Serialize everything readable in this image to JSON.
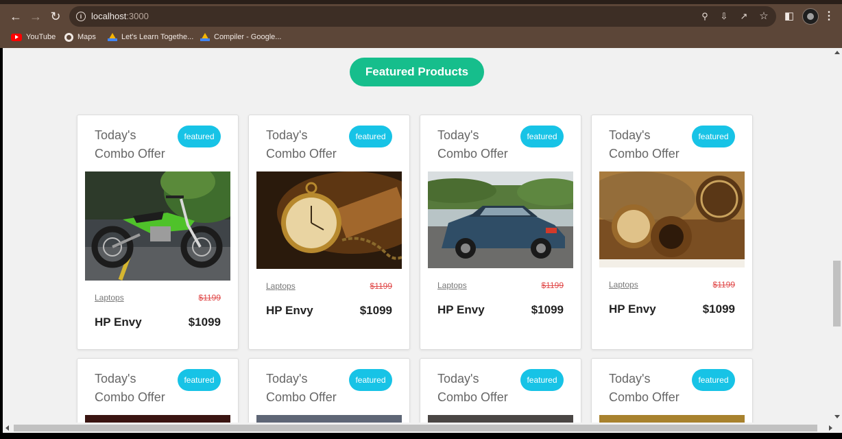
{
  "browser": {
    "url_host": "localhost",
    "url_port": ":3000",
    "bookmarks": [
      "YouTube",
      "Maps",
      "Let's Learn Togethe...",
      "Compiler - Google..."
    ]
  },
  "page": {
    "heading": "Featured Products",
    "accent_color": "#16be8c",
    "badge_color": "#17c3e6",
    "products": [
      {
        "title": "Today's Combo Offer",
        "badge": "featured",
        "image": "green dirt bike",
        "category": "Laptops",
        "old_price": "$1199",
        "name": "HP Envy",
        "price": "$1099"
      },
      {
        "title": "Today's Combo Offer",
        "badge": "featured",
        "image": "vintage pocket watch",
        "category": "Laptops",
        "old_price": "$1199",
        "name": "HP Envy",
        "price": "$1099"
      },
      {
        "title": "Today's Combo Offer",
        "badge": "featured",
        "image": "blue sedan car",
        "category": "Laptops",
        "old_price": "$1199",
        "name": "HP Envy",
        "price": "$1099"
      },
      {
        "title": "Today's Combo Offer",
        "badge": "featured",
        "image": "antique compass and globe",
        "category": "Laptops",
        "old_price": "$1199",
        "name": "HP Envy",
        "price": "$1099"
      },
      {
        "title": "Today's Combo Offer",
        "badge": "featured"
      },
      {
        "title": "Today's Combo Offer",
        "badge": "featured"
      },
      {
        "title": "Today's Combo Offer",
        "badge": "featured"
      },
      {
        "title": "Today's Combo Offer",
        "badge": "featured"
      }
    ]
  }
}
